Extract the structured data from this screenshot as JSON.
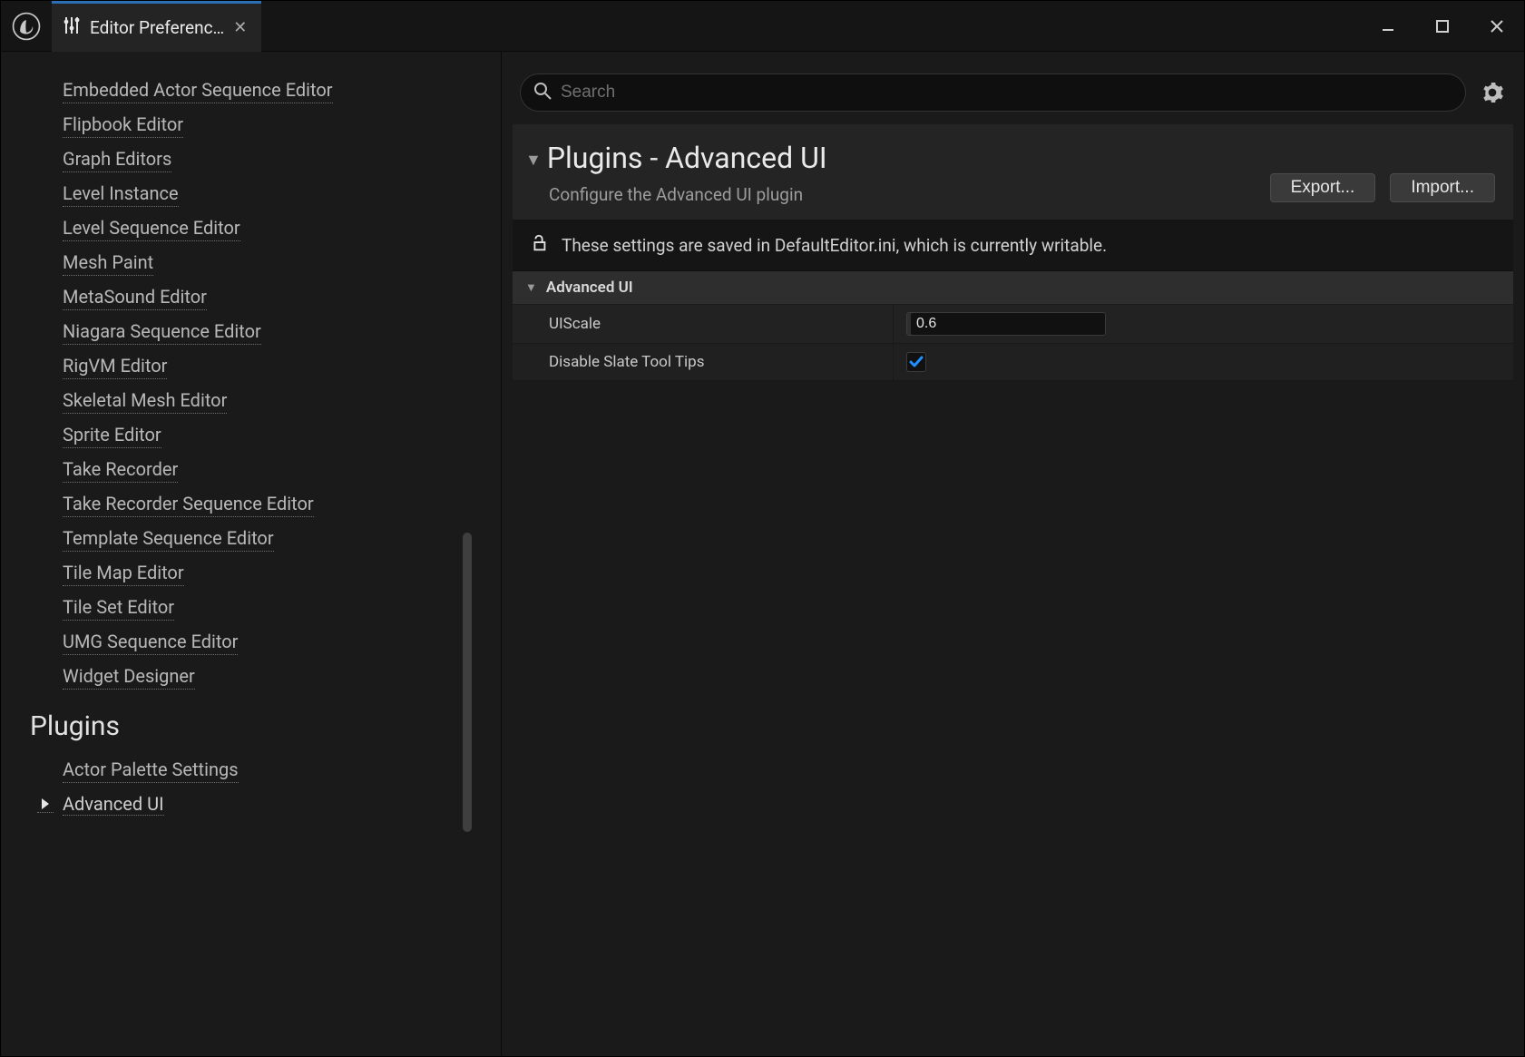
{
  "tab": {
    "label": "Editor Preferenc…"
  },
  "sidebar": {
    "items": [
      {
        "label": "Embedded Actor Sequence Editor"
      },
      {
        "label": "Flipbook Editor"
      },
      {
        "label": "Graph Editors"
      },
      {
        "label": "Level Instance"
      },
      {
        "label": "Level Sequence Editor"
      },
      {
        "label": "Mesh Paint"
      },
      {
        "label": "MetaSound Editor"
      },
      {
        "label": "Niagara Sequence Editor"
      },
      {
        "label": "RigVM Editor"
      },
      {
        "label": "Skeletal Mesh Editor"
      },
      {
        "label": "Sprite Editor"
      },
      {
        "label": "Take Recorder"
      },
      {
        "label": "Take Recorder Sequence Editor"
      },
      {
        "label": "Template Sequence Editor"
      },
      {
        "label": "Tile Map Editor"
      },
      {
        "label": "Tile Set Editor"
      },
      {
        "label": "UMG Sequence Editor"
      },
      {
        "label": "Widget Designer"
      }
    ],
    "group_header": "Plugins",
    "plugin_items": [
      {
        "label": "Actor Palette Settings"
      },
      {
        "label": "Advanced UI",
        "selected": true
      }
    ]
  },
  "search": {
    "placeholder": "Search"
  },
  "section": {
    "title": "Plugins - Advanced UI",
    "subtitle": "Configure the Advanced UI plugin",
    "export": "Export...",
    "import": "Import..."
  },
  "writable_notice": "These settings are saved in DefaultEditor.ini, which is currently writable.",
  "category": {
    "title": "Advanced UI"
  },
  "props": {
    "uiscale": {
      "label": "UIScale",
      "value": "0.6"
    },
    "disable_tooltips": {
      "label": "Disable Slate Tool Tips",
      "checked": true
    }
  }
}
